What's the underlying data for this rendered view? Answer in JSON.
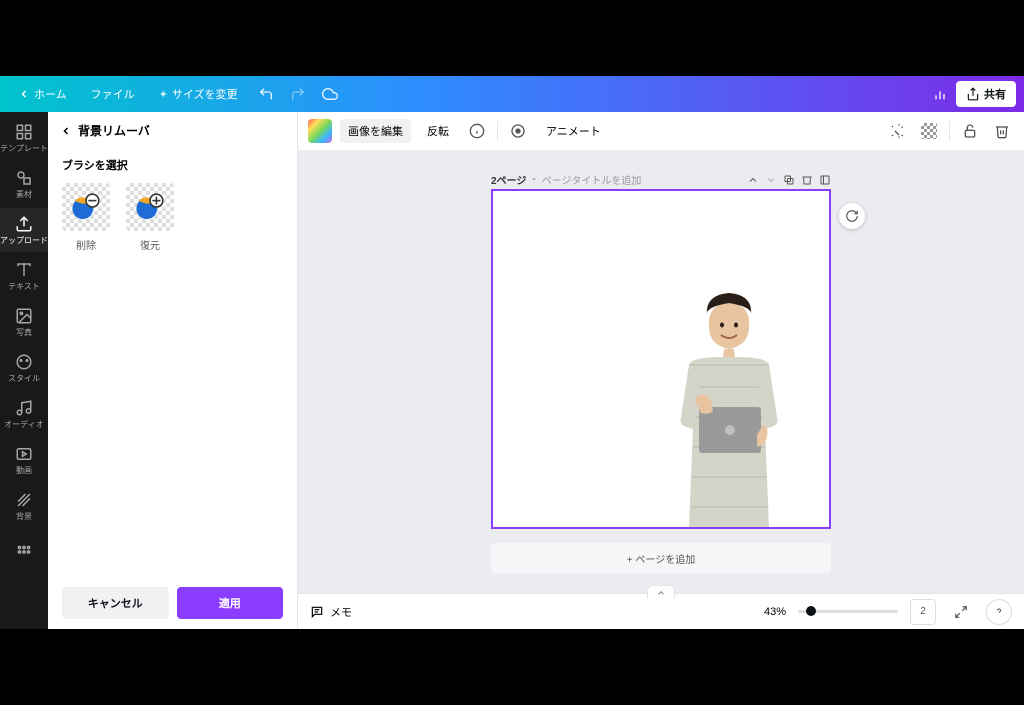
{
  "topbar": {
    "home": "ホーム",
    "file": "ファイル",
    "resize": "サイズを変更",
    "share": "共有"
  },
  "rail": {
    "items": [
      {
        "label": "テンプレート"
      },
      {
        "label": "素材"
      },
      {
        "label": "アップロード"
      },
      {
        "label": "テキスト"
      },
      {
        "label": "写真"
      },
      {
        "label": "スタイル"
      },
      {
        "label": "オーディオ"
      },
      {
        "label": "動画"
      },
      {
        "label": "背景"
      }
    ]
  },
  "panel": {
    "title": "背景リムーバ",
    "section": "ブラシを選択",
    "erase": "削除",
    "restore": "復元",
    "cancel": "キャンセル",
    "apply": "適用"
  },
  "context": {
    "edit_image": "画像を編集",
    "flip": "反転",
    "animate": "アニメート"
  },
  "page": {
    "number": "2ページ",
    "title_placeholder": "ページタイトルを追加",
    "add_page": "+ ページを追加"
  },
  "footer": {
    "notes": "メモ",
    "zoom": "43%",
    "page_count": "2"
  }
}
